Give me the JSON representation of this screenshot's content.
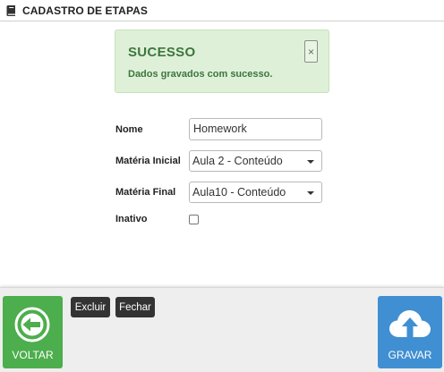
{
  "header": {
    "title": "CADASTRO DE ETAPAS",
    "icon": "book-icon"
  },
  "alert": {
    "title": "SUCESSO",
    "message": "Dados gravados com sucesso.",
    "close_symbol": "×",
    "color": "#3c763d",
    "background": "#dff0d8"
  },
  "form": {
    "nome_label": "Nome",
    "nome_value": "Homework",
    "materia_inicial_label": "Matéria Inicial",
    "materia_inicial_value": "Aula 2 - Conteúdo",
    "materia_final_label": "Matéria Final",
    "materia_final_value": "Aula10 - Conteúdo",
    "inativo_label": "Inativo",
    "inativo_checked": false
  },
  "footer": {
    "voltar_label": "VOLTAR",
    "excluir_label": "Excluir",
    "fechar_label": "Fechar",
    "gravar_label": "GRAVAR",
    "voltar_color": "#4cae4c",
    "gravar_color": "#3f8fd2"
  }
}
